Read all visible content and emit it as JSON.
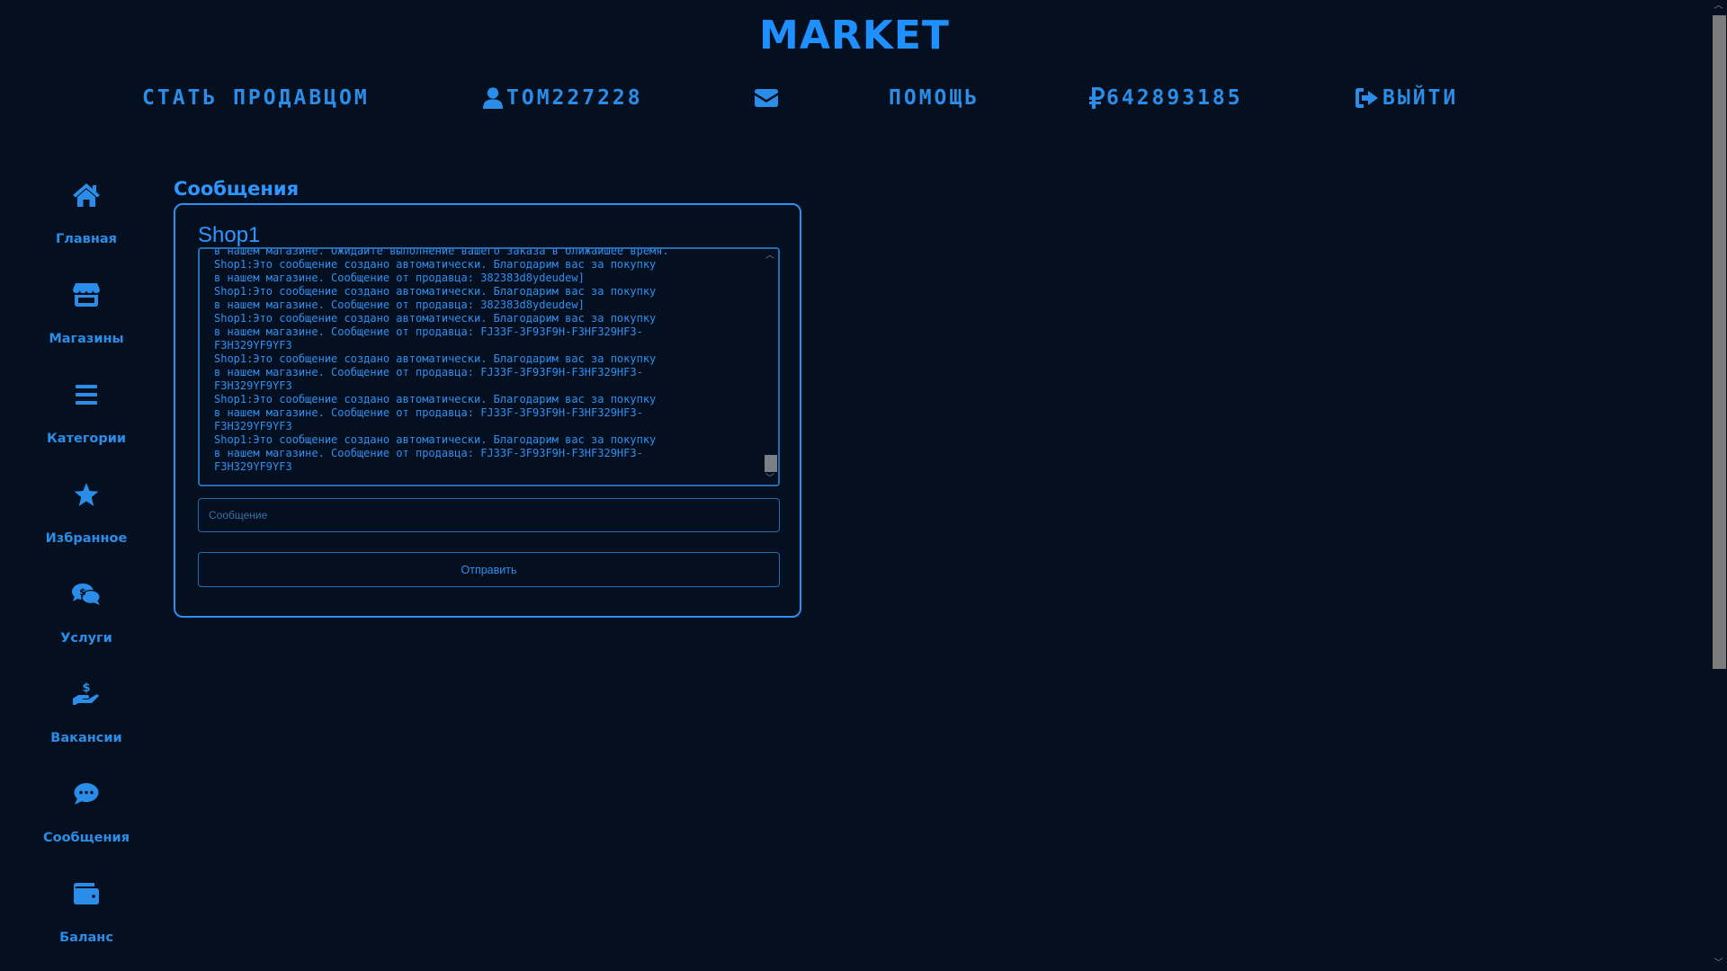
{
  "brand": "MARKET",
  "nav": {
    "become_seller": "СТАТЬ ПРОДАВЦОМ",
    "username": "TOM227228",
    "help": "ПОМОЩЬ",
    "balance": "642893185",
    "logout": "ВЫЙТИ"
  },
  "sidebar": {
    "items": [
      {
        "label": "Главная",
        "icon": "home-icon"
      },
      {
        "label": "Магазины",
        "icon": "store-icon"
      },
      {
        "label": "Категории",
        "icon": "list-icon"
      },
      {
        "label": "Избранное",
        "icon": "star-icon"
      },
      {
        "label": "Услуги",
        "icon": "comments-dollar-icon"
      },
      {
        "label": "Вакансии",
        "icon": "hand-dollar-icon"
      },
      {
        "label": "Сообщения",
        "icon": "comment-icon"
      },
      {
        "label": "Баланс",
        "icon": "wallet-icon"
      }
    ]
  },
  "messages": {
    "title": "Сообщения",
    "shop_name": "Shop1",
    "log": "в нашем магазине. Ожидайте выполнение вашего заказа в ближайшее время.\nShop1:Это сообщение создано автоматически. Благодарим вас за покупку\nв нашем магазине. Сообщение от продавца: 382383d8ydeudew]\nShop1:Это сообщение создано автоматически. Благодарим вас за покупку\nв нашем магазине. Сообщение от продавца: 382383d8ydeudew]\nShop1:Это сообщение создано автоматически. Благодарим вас за покупку\nв нашем магазине. Сообщение от продавца: FJ33F-3F93F9H-F3HF329HF3-\nF3H329YF9YF3\nShop1:Это сообщение создано автоматически. Благодарим вас за покупку\nв нашем магазине. Сообщение от продавца: FJ33F-3F93F9H-F3HF329HF3-\nF3H329YF9YF3\nShop1:Это сообщение создано автоматически. Благодарим вас за покупку\nв нашем магазине. Сообщение от продавца: FJ33F-3F93F9H-F3HF329HF3-\nF3H329YF9YF3\nShop1:Это сообщение создано автоматически. Благодарим вас за покупку\nв нашем магазине. Сообщение от продавца: FJ33F-3F93F9H-F3HF329HF3-\nF3H329YF9YF3",
    "input_value": "",
    "input_placeholder": "Сообщение",
    "send_label": "Отправить"
  },
  "colors": {
    "background": "#04101f",
    "accent": "#2b8de8",
    "brand": "#1e90ff"
  }
}
